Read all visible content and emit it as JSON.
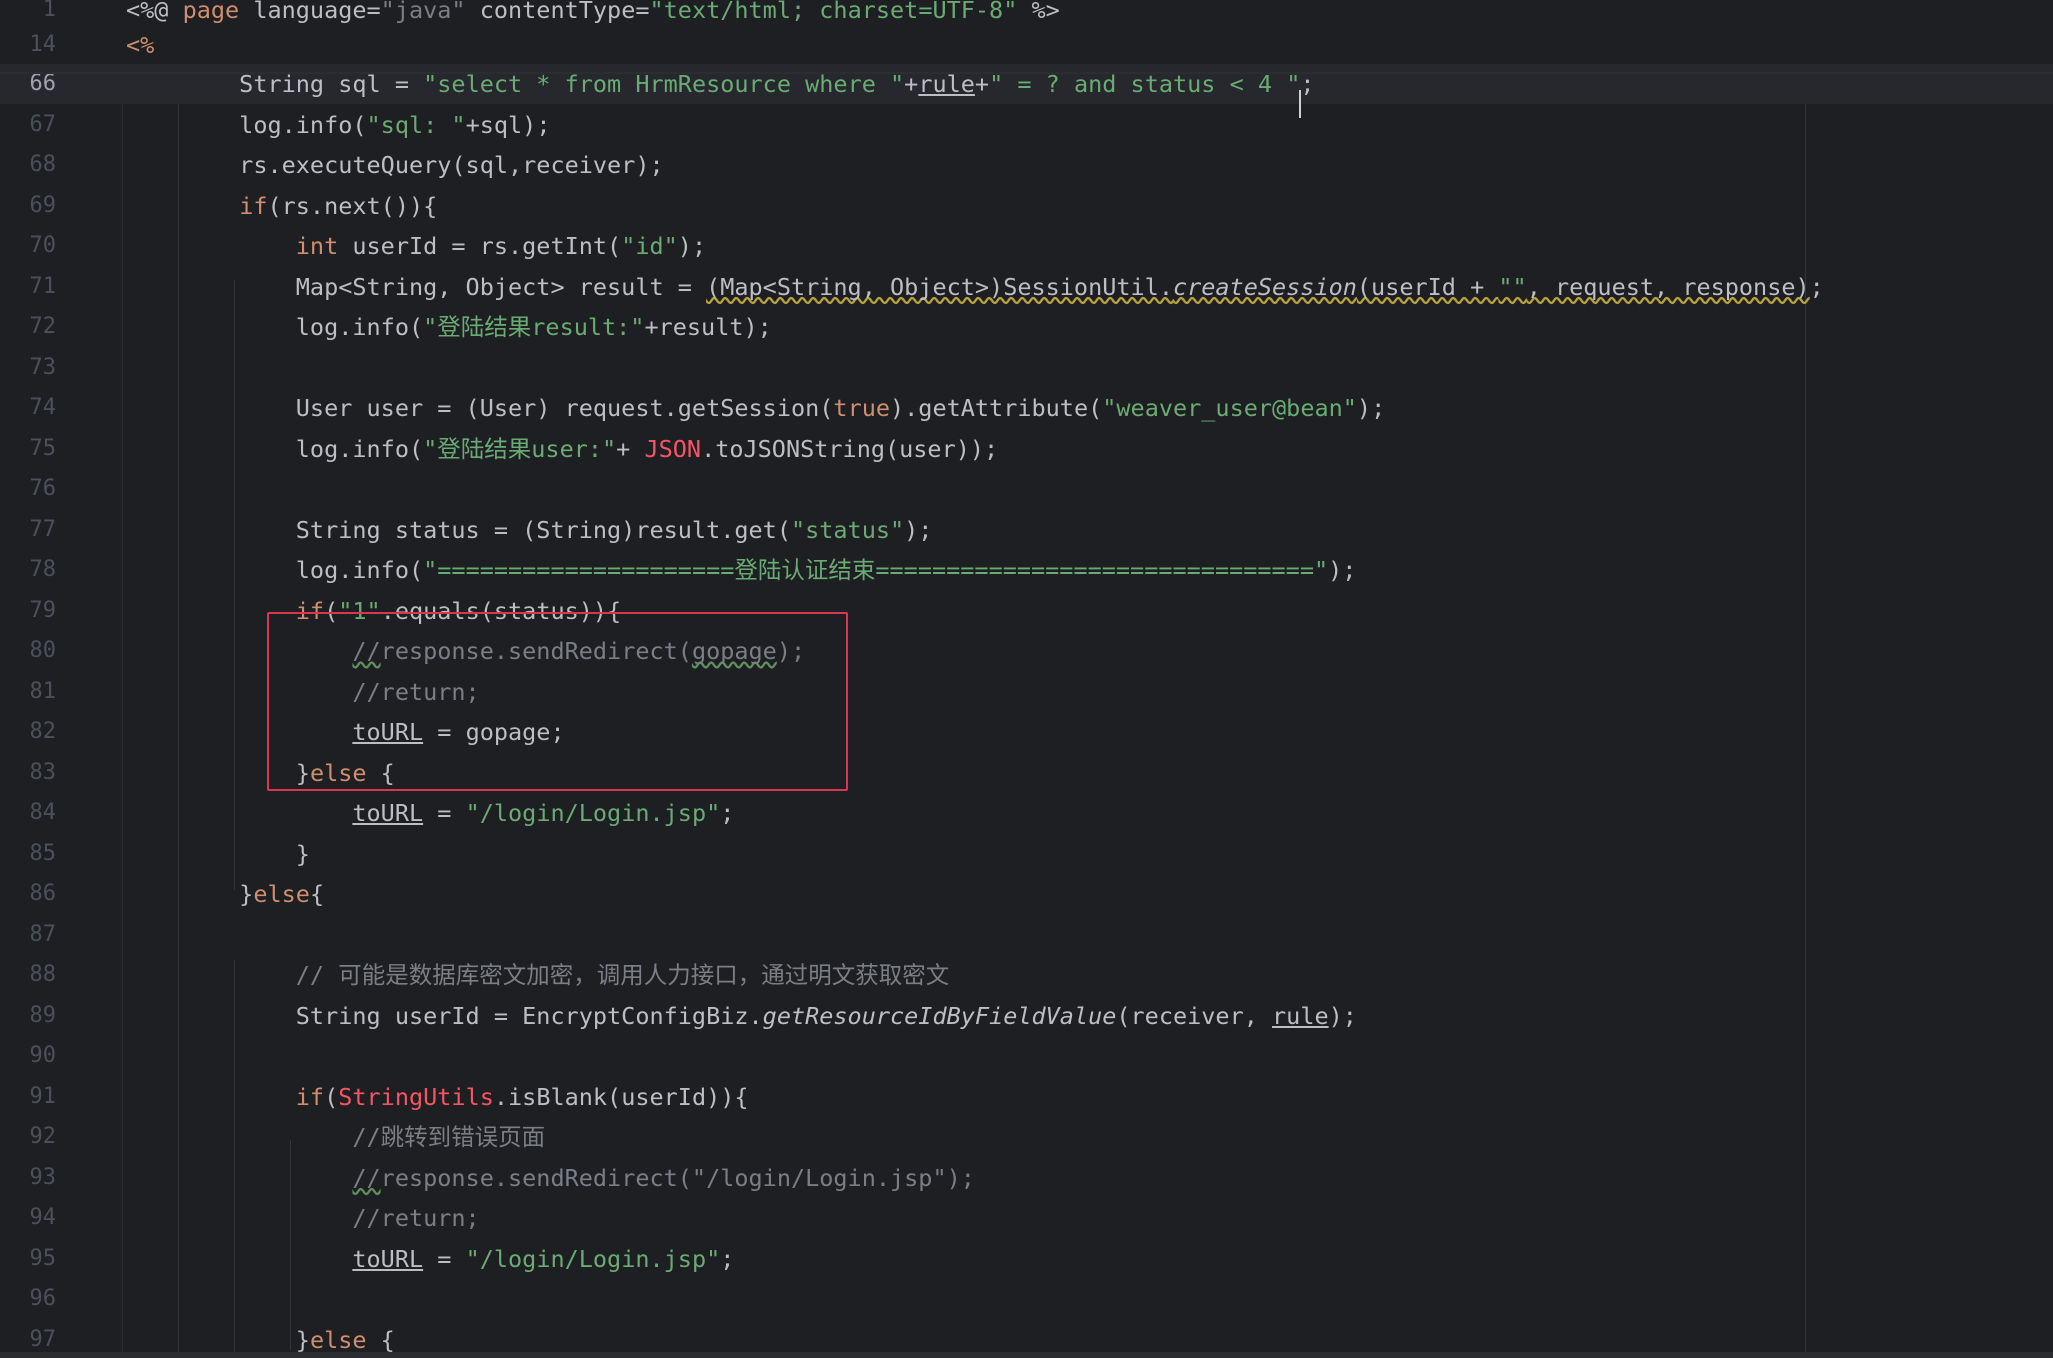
{
  "editor": {
    "language": "JSP",
    "colors": {
      "background": "#1e1f22",
      "current_line": "#26282e",
      "keyword": "#cf8e6d",
      "string": "#6aab73",
      "comment": "#7a7e85",
      "identifier_error": "#f75464",
      "plain": "#bcbec4",
      "line_number": "#4b5059",
      "highlight_box": "#d8374d"
    },
    "sticky_lines": [
      {
        "num": "1",
        "tokens": [
          [
            "<%@ ",
            ""
          ],
          [
            "page",
            "kw"
          ],
          [
            " language=",
            ""
          ],
          [
            "\"java\"",
            "cmt"
          ],
          [
            " contentType=",
            ""
          ],
          [
            "\"text/html; charset=UTF-8\"",
            "str"
          ],
          [
            " %>",
            ""
          ]
        ]
      },
      {
        "num": "14",
        "tokens": [
          [
            "<%",
            "kw"
          ]
        ]
      }
    ],
    "lines": [
      {
        "num": "66",
        "current": true,
        "tokens": [
          [
            "        String sql = ",
            ""
          ],
          [
            "\"select * from HrmResource where \"",
            "str"
          ],
          [
            "+",
            ""
          ],
          [
            "rule",
            "ul"
          ],
          [
            "+",
            ""
          ],
          [
            "\" = ? and status < 4 \"",
            "str"
          ],
          [
            ";",
            ""
          ]
        ]
      },
      {
        "num": "67",
        "tokens": [
          [
            "        log.info(",
            ""
          ],
          [
            "\"sql: \"",
            "str"
          ],
          [
            "+sql);",
            ""
          ]
        ]
      },
      {
        "num": "68",
        "tokens": [
          [
            "        rs.executeQuery(sql,receiver);",
            ""
          ]
        ]
      },
      {
        "num": "69",
        "tokens": [
          [
            "        ",
            ""
          ],
          [
            "if",
            "kw"
          ],
          [
            "(rs.next()){",
            ""
          ]
        ]
      },
      {
        "num": "70",
        "tokens": [
          [
            "            ",
            ""
          ],
          [
            "int",
            "kw"
          ],
          [
            " userId = rs.getInt(",
            ""
          ],
          [
            "\"id\"",
            "str"
          ],
          [
            ");",
            ""
          ]
        ]
      },
      {
        "num": "71",
        "tokens": [
          [
            "            Map<String, Object> result = ",
            ""
          ],
          [
            "(Map<String, Object>)SessionUtil.",
            "wavy"
          ],
          [
            "createSession",
            "wavy-it"
          ],
          [
            "(userId + ",
            "wavy"
          ],
          [
            "\"\"",
            "wavy-str"
          ],
          [
            ", request, response)",
            "wavy"
          ],
          [
            ";",
            ""
          ]
        ]
      },
      {
        "num": "72",
        "tokens": [
          [
            "            log.info(",
            ""
          ],
          [
            "\"登陆结果result:\"",
            "str"
          ],
          [
            "+result);",
            ""
          ]
        ]
      },
      {
        "num": "73",
        "tokens": [
          [
            "",
            ""
          ]
        ]
      },
      {
        "num": "74",
        "tokens": [
          [
            "            User user = (User) request.getSession(",
            ""
          ],
          [
            "true",
            "kw"
          ],
          [
            ").getAttribute(",
            ""
          ],
          [
            "\"weaver_user@bean\"",
            "str"
          ],
          [
            ");",
            ""
          ]
        ]
      },
      {
        "num": "75",
        "tokens": [
          [
            "            log.info(",
            ""
          ],
          [
            "\"登陆结果user:\"",
            "str"
          ],
          [
            "+ ",
            ""
          ],
          [
            "JSON",
            "red"
          ],
          [
            ".toJSONString(user));",
            ""
          ]
        ]
      },
      {
        "num": "76",
        "tokens": [
          [
            "",
            ""
          ]
        ]
      },
      {
        "num": "77",
        "tokens": [
          [
            "            String status = (String)result.get(",
            ""
          ],
          [
            "\"status\"",
            "str"
          ],
          [
            ");",
            ""
          ]
        ]
      },
      {
        "num": "78",
        "tokens": [
          [
            "            log.info(",
            ""
          ],
          [
            "\"=====================登陆认证结束===============================\"",
            "str"
          ],
          [
            ");",
            ""
          ]
        ]
      },
      {
        "num": "79",
        "tokens": [
          [
            "            ",
            ""
          ],
          [
            "if",
            "kw"
          ],
          [
            "(",
            ""
          ],
          [
            "\"1\"",
            "str"
          ],
          [
            ".equals(status)){",
            ""
          ]
        ]
      },
      {
        "num": "80",
        "tokens": [
          [
            "                ",
            ""
          ],
          [
            "//",
            "cmt-wavy"
          ],
          [
            "response.sendRedirect(",
            "cmt"
          ],
          [
            "gopage",
            "cmt-wavy"
          ],
          [
            ");",
            "cmt"
          ]
        ]
      },
      {
        "num": "81",
        "tokens": [
          [
            "                ",
            ""
          ],
          [
            "//return;",
            "cmt"
          ]
        ]
      },
      {
        "num": "82",
        "tokens": [
          [
            "                ",
            ""
          ],
          [
            "toURL",
            "ul"
          ],
          [
            " = gopage;",
            ""
          ]
        ]
      },
      {
        "num": "83",
        "tokens": [
          [
            "            }",
            ""
          ],
          [
            "else",
            "kw"
          ],
          [
            " {",
            ""
          ]
        ]
      },
      {
        "num": "84",
        "tokens": [
          [
            "                ",
            ""
          ],
          [
            "toURL",
            "ul"
          ],
          [
            " = ",
            ""
          ],
          [
            "\"/login/Login.jsp\"",
            "str"
          ],
          [
            ";",
            ""
          ]
        ]
      },
      {
        "num": "85",
        "tokens": [
          [
            "            }",
            ""
          ]
        ]
      },
      {
        "num": "86",
        "tokens": [
          [
            "        }",
            ""
          ],
          [
            "else",
            "kw"
          ],
          [
            "{",
            ""
          ]
        ]
      },
      {
        "num": "87",
        "tokens": [
          [
            "",
            ""
          ]
        ]
      },
      {
        "num": "88",
        "tokens": [
          [
            "            ",
            ""
          ],
          [
            "// 可能是数据库密文加密，调用人力接口，通过明文获取密文",
            "cmt"
          ]
        ]
      },
      {
        "num": "89",
        "tokens": [
          [
            "            String userId = EncryptConfigBiz.",
            ""
          ],
          [
            "getResourceIdByFieldValue",
            "it"
          ],
          [
            "(receiver, ",
            ""
          ],
          [
            "rule",
            "ul"
          ],
          [
            ");",
            ""
          ]
        ]
      },
      {
        "num": "90",
        "tokens": [
          [
            "",
            ""
          ]
        ]
      },
      {
        "num": "91",
        "tokens": [
          [
            "            ",
            ""
          ],
          [
            "if",
            "kw"
          ],
          [
            "(",
            ""
          ],
          [
            "StringUtils",
            "red"
          ],
          [
            ".isBlank(userId)){",
            ""
          ]
        ]
      },
      {
        "num": "92",
        "tokens": [
          [
            "                ",
            ""
          ],
          [
            "//跳转到错误页面",
            "cmt"
          ]
        ]
      },
      {
        "num": "93",
        "tokens": [
          [
            "                ",
            ""
          ],
          [
            "//",
            "cmt-wavy"
          ],
          [
            "response.sendRedirect(\"/login/Login.jsp\");",
            "cmt"
          ]
        ]
      },
      {
        "num": "94",
        "tokens": [
          [
            "                ",
            ""
          ],
          [
            "//return;",
            "cmt"
          ]
        ]
      },
      {
        "num": "95",
        "tokens": [
          [
            "                ",
            ""
          ],
          [
            "toURL",
            "ul"
          ],
          [
            " = ",
            ""
          ],
          [
            "\"/login/Login.jsp\"",
            "str"
          ],
          [
            ";",
            ""
          ]
        ]
      },
      {
        "num": "96",
        "tokens": [
          [
            "",
            ""
          ]
        ]
      },
      {
        "num": "97",
        "tokens": [
          [
            "            }",
            ""
          ],
          [
            "else",
            "kw"
          ],
          [
            " {",
            ""
          ]
        ]
      }
    ]
  }
}
